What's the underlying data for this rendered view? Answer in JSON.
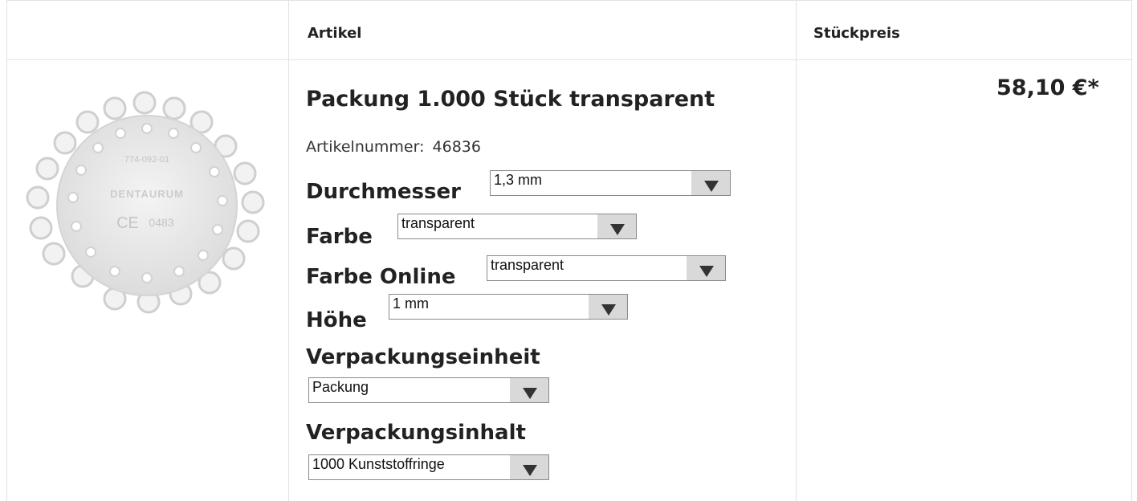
{
  "header": {
    "col_article": "Artikel",
    "col_price": "Stückpreis"
  },
  "product": {
    "image_alt": "Kunststoffringe transparent",
    "logo_text": "DENTAURUM",
    "part_text": "774-092-01",
    "ce_text": "0483",
    "title": "Packung 1.000 Stück transparent",
    "article_number_label": "Artikelnummer:",
    "article_number": "46836",
    "price": "58,10 €*"
  },
  "options": [
    {
      "label": "Durchmesser",
      "value": "1,3 mm"
    },
    {
      "label": "Farbe",
      "value": "transparent"
    },
    {
      "label": "Farbe Online",
      "value": "transparent"
    },
    {
      "label": "Höhe",
      "value": "1 mm"
    },
    {
      "label": "Verpackungseinheit",
      "value": "Packung"
    },
    {
      "label": "Verpackungsinhalt",
      "value": "1000 Kunststoffringe"
    }
  ]
}
